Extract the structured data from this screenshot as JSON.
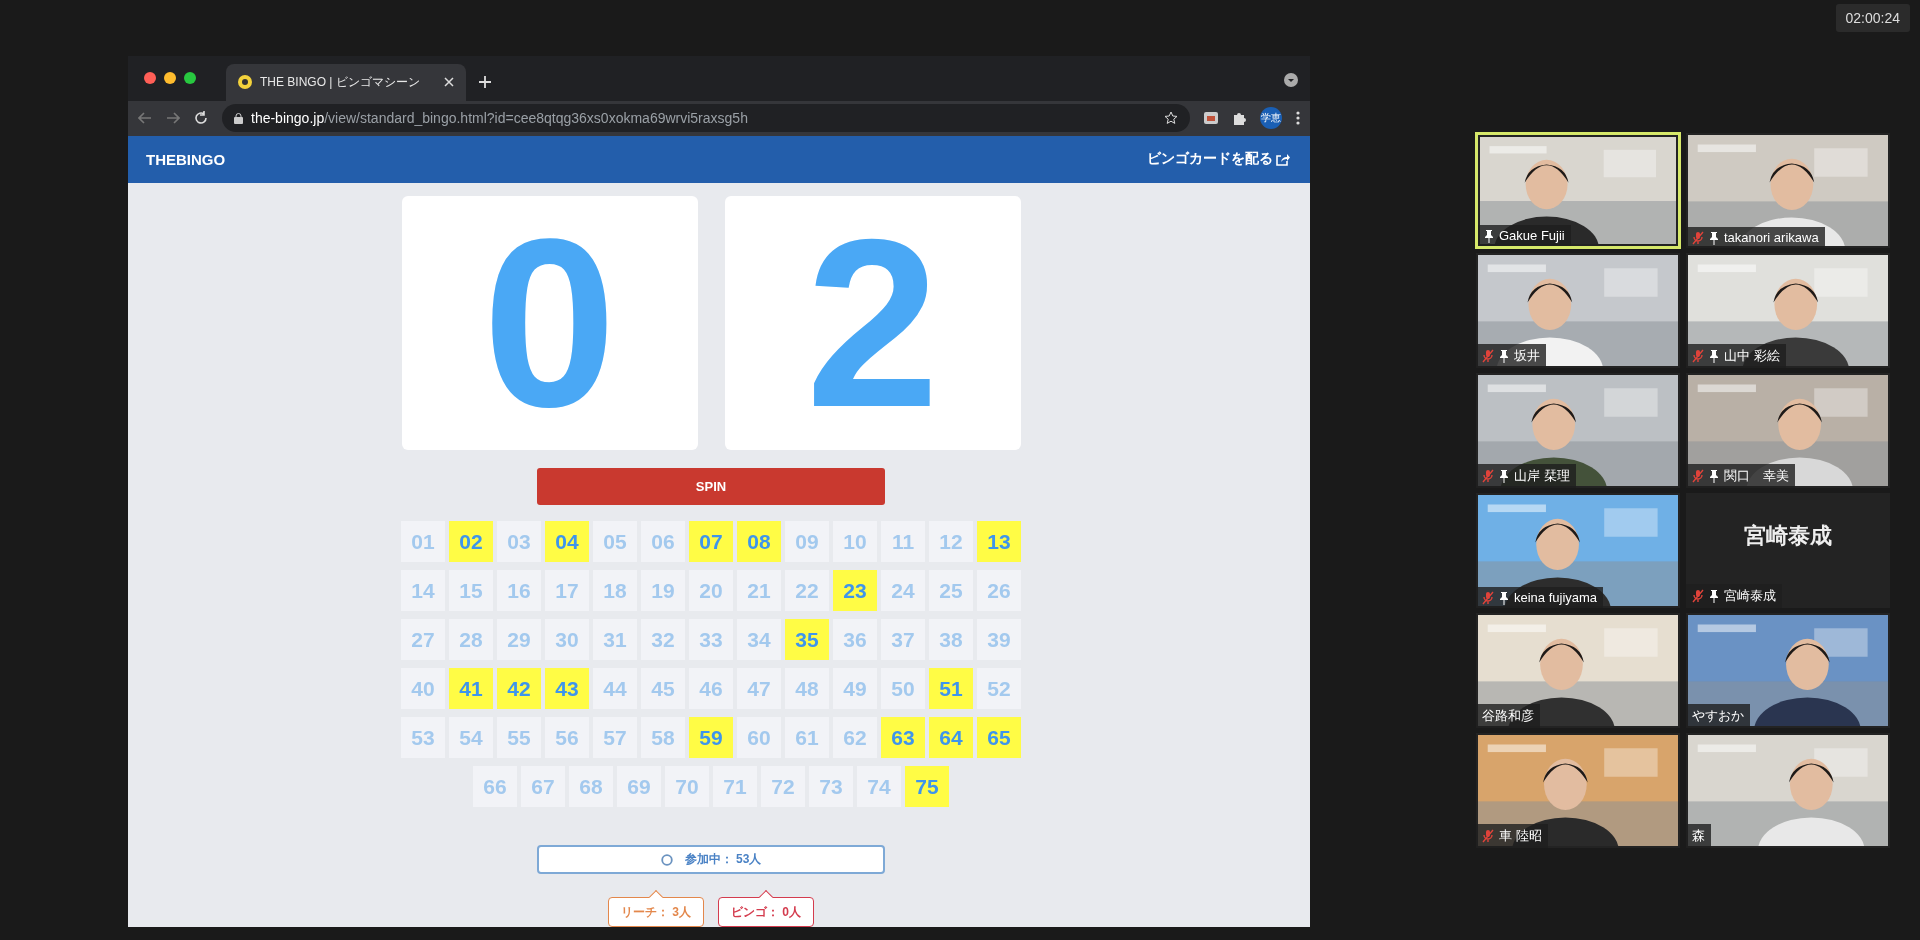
{
  "timer": "02:00:24",
  "browser": {
    "tab_title": "THE BINGO | ビンゴマシーン",
    "url_host": "the-bingo.jp",
    "url_path": "/view/standard_bingo.html?id=cee8qtqg36xs0xokma69wrvi5raxsg5h",
    "profile": "学恵"
  },
  "header": {
    "logo": "THEBINGO",
    "action": "ビンゴカードを配る"
  },
  "digits": [
    "0",
    "2"
  ],
  "spin_button": "SPIN",
  "numbers": [
    {
      "label": "01",
      "selected": false
    },
    {
      "label": "02",
      "selected": true
    },
    {
      "label": "03",
      "selected": false
    },
    {
      "label": "04",
      "selected": true
    },
    {
      "label": "05",
      "selected": false
    },
    {
      "label": "06",
      "selected": false
    },
    {
      "label": "07",
      "selected": true
    },
    {
      "label": "08",
      "selected": true
    },
    {
      "label": "09",
      "selected": false
    },
    {
      "label": "10",
      "selected": false
    },
    {
      "label": "11",
      "selected": false
    },
    {
      "label": "12",
      "selected": false
    },
    {
      "label": "13",
      "selected": true
    },
    {
      "label": "14",
      "selected": false
    },
    {
      "label": "15",
      "selected": false
    },
    {
      "label": "16",
      "selected": false
    },
    {
      "label": "17",
      "selected": false
    },
    {
      "label": "18",
      "selected": false
    },
    {
      "label": "19",
      "selected": false
    },
    {
      "label": "20",
      "selected": false
    },
    {
      "label": "21",
      "selected": false
    },
    {
      "label": "22",
      "selected": false
    },
    {
      "label": "23",
      "selected": true
    },
    {
      "label": "24",
      "selected": false
    },
    {
      "label": "25",
      "selected": false
    },
    {
      "label": "26",
      "selected": false
    },
    {
      "label": "27",
      "selected": false
    },
    {
      "label": "28",
      "selected": false
    },
    {
      "label": "29",
      "selected": false
    },
    {
      "label": "30",
      "selected": false
    },
    {
      "label": "31",
      "selected": false
    },
    {
      "label": "32",
      "selected": false
    },
    {
      "label": "33",
      "selected": false
    },
    {
      "label": "34",
      "selected": false
    },
    {
      "label": "35",
      "selected": true
    },
    {
      "label": "36",
      "selected": false
    },
    {
      "label": "37",
      "selected": false
    },
    {
      "label": "38",
      "selected": false
    },
    {
      "label": "39",
      "selected": false
    },
    {
      "label": "40",
      "selected": false
    },
    {
      "label": "41",
      "selected": true
    },
    {
      "label": "42",
      "selected": true
    },
    {
      "label": "43",
      "selected": true
    },
    {
      "label": "44",
      "selected": false
    },
    {
      "label": "45",
      "selected": false
    },
    {
      "label": "46",
      "selected": false
    },
    {
      "label": "47",
      "selected": false
    },
    {
      "label": "48",
      "selected": false
    },
    {
      "label": "49",
      "selected": false
    },
    {
      "label": "50",
      "selected": false
    },
    {
      "label": "51",
      "selected": true
    },
    {
      "label": "52",
      "selected": false
    },
    {
      "label": "53",
      "selected": false
    },
    {
      "label": "54",
      "selected": false
    },
    {
      "label": "55",
      "selected": false
    },
    {
      "label": "56",
      "selected": false
    },
    {
      "label": "57",
      "selected": false
    },
    {
      "label": "58",
      "selected": false
    },
    {
      "label": "59",
      "selected": true
    },
    {
      "label": "60",
      "selected": false
    },
    {
      "label": "61",
      "selected": false
    },
    {
      "label": "62",
      "selected": false
    },
    {
      "label": "63",
      "selected": true
    },
    {
      "label": "64",
      "selected": true
    },
    {
      "label": "65",
      "selected": true
    },
    {
      "label": "66",
      "selected": false
    },
    {
      "label": "67",
      "selected": false
    },
    {
      "label": "68",
      "selected": false
    },
    {
      "label": "69",
      "selected": false
    },
    {
      "label": "70",
      "selected": false
    },
    {
      "label": "71",
      "selected": false
    },
    {
      "label": "72",
      "selected": false
    },
    {
      "label": "73",
      "selected": false
    },
    {
      "label": "74",
      "selected": false
    },
    {
      "label": "75",
      "selected": true
    }
  ],
  "participants": "参加中： 53人",
  "stats": [
    {
      "kind": "reach",
      "label": "リーチ： 3人"
    },
    {
      "kind": "bingo",
      "label": "ビンゴ： 0人"
    }
  ],
  "video_tiles": [
    {
      "kind": "video",
      "name": "Gakue Fujii",
      "muted": false,
      "pinned": true,
      "speaking": true
    },
    {
      "kind": "video",
      "name": "takanori arikawa",
      "muted": true,
      "pinned": true,
      "speaking": false
    },
    {
      "kind": "video",
      "name": "坂井",
      "muted": true,
      "pinned": true,
      "speaking": false
    },
    {
      "kind": "video",
      "name": "山中 彩絵",
      "muted": true,
      "pinned": true,
      "speaking": false
    },
    {
      "kind": "video",
      "name": "山岸 栞理",
      "muted": true,
      "pinned": true,
      "speaking": false
    },
    {
      "kind": "video",
      "name": "関口　幸美",
      "muted": true,
      "pinned": true,
      "speaking": false
    },
    {
      "kind": "video",
      "name": "keina fujiyama",
      "muted": true,
      "pinned": true,
      "speaking": false
    },
    {
      "kind": "name",
      "display": "宮崎泰成",
      "name": "宮崎泰成",
      "muted": true,
      "pinned": true,
      "speaking": false
    },
    {
      "kind": "video",
      "name": "谷路和彦",
      "muted": false,
      "pinned": false,
      "speaking": false
    },
    {
      "kind": "video",
      "name": "やすおか",
      "muted": false,
      "pinned": false,
      "speaking": false
    },
    {
      "kind": "video",
      "name": "車 陸昭",
      "muted": true,
      "pinned": false,
      "speaking": false
    },
    {
      "kind": "video",
      "name": "森",
      "muted": false,
      "pinned": false,
      "speaking": false
    }
  ]
}
